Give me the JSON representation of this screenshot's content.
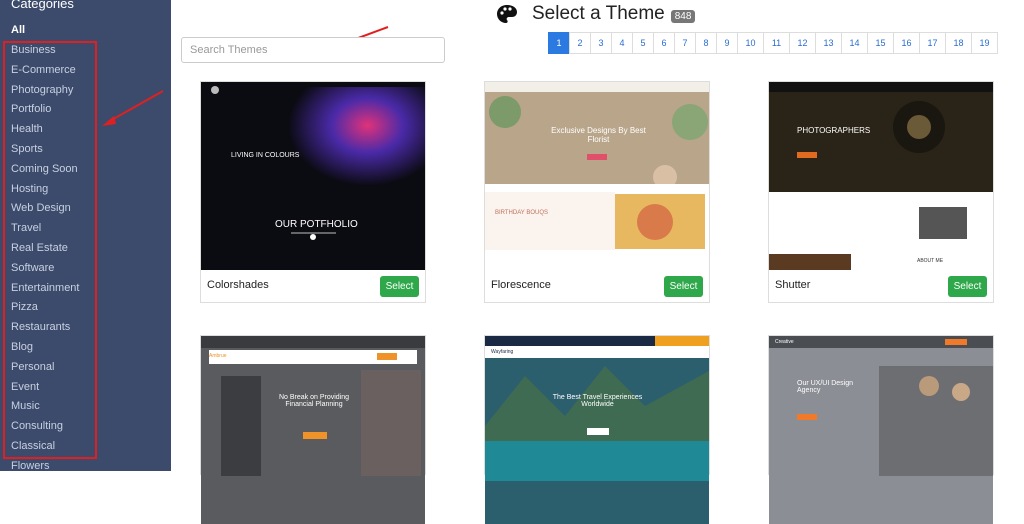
{
  "sidebar": {
    "title": "Categories",
    "all_label": "All",
    "items": [
      "Business",
      "E-Commerce",
      "Photography",
      "Portfolio",
      "Health",
      "Sports",
      "Coming Soon",
      "Hosting",
      "Web Design",
      "Travel",
      "Real Estate",
      "Software",
      "Entertainment",
      "Pizza",
      "Restaurants",
      "Blog",
      "Personal",
      "Event",
      "Music",
      "Consulting",
      "Classical",
      "Flowers"
    ]
  },
  "header": {
    "title": "Select a Theme",
    "count": "848"
  },
  "search": {
    "placeholder": "Search Themes"
  },
  "pagination": {
    "pages": [
      "1",
      "2",
      "3",
      "4",
      "5",
      "6",
      "7",
      "8",
      "9",
      "10",
      "11",
      "12",
      "13",
      "14",
      "15",
      "16",
      "17",
      "18",
      "19"
    ],
    "active": "1"
  },
  "themes": [
    {
      "name": "Colorshades",
      "select_label": "Select",
      "preview": {
        "heading": "LIVING IN COLOURS",
        "sub": "OUR POTFHOLIO"
      }
    },
    {
      "name": "Florescence",
      "select_label": "Select",
      "preview": {
        "heading": "Exclusive Designs By Best Florist",
        "sub": "BIRTHDAY BOUQS"
      }
    },
    {
      "name": "Shutter",
      "select_label": "Select",
      "preview": {
        "heading": "PHOTOGRAPHERS",
        "sub": "ABOUT ME"
      }
    },
    {
      "name": "",
      "select_label": "",
      "preview": {
        "heading": "No Break on Providing Financial Planning",
        "sub": "Ambrue"
      }
    },
    {
      "name": "",
      "select_label": "",
      "preview": {
        "heading": "The Best Travel Experiences Worldwide",
        "sub": "Wayfaring"
      }
    },
    {
      "name": "",
      "select_label": "",
      "preview": {
        "heading": "Our UX/UI Design Agency",
        "sub": "Creative"
      }
    }
  ],
  "colors": {
    "sidebar_bg": "#3c4b6b",
    "active_page": "#2a7ae2",
    "select_green": "#2ea84a",
    "highlight_red": "#e02020"
  }
}
